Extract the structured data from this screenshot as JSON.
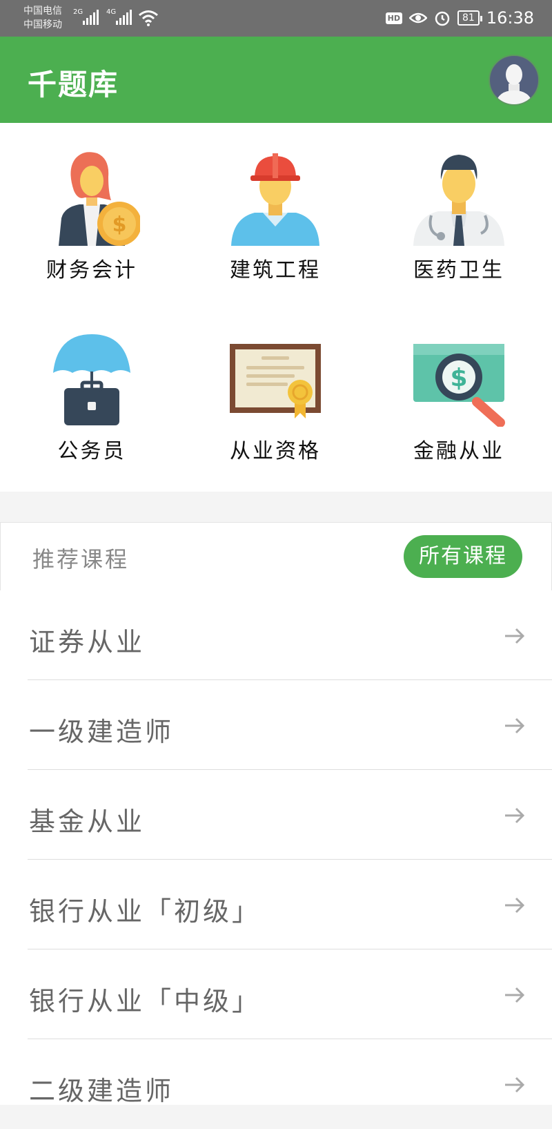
{
  "status_bar": {
    "carrier_1": "中国电信",
    "carrier_2": "中国移动",
    "net_1": "2G",
    "net_2": "4G",
    "hd": "HD",
    "battery": "81",
    "time": "16:38"
  },
  "header": {
    "title": "千题库"
  },
  "categories": [
    {
      "label": "财务会计",
      "icon": "accountant-icon"
    },
    {
      "label": "建筑工程",
      "icon": "construction-worker-icon"
    },
    {
      "label": "医药卫生",
      "icon": "doctor-icon"
    },
    {
      "label": "公务员",
      "icon": "umbrella-briefcase-icon"
    },
    {
      "label": "从业资格",
      "icon": "certificate-icon"
    },
    {
      "label": "金融从业",
      "icon": "money-magnifier-icon"
    }
  ],
  "recommend": {
    "title": "推荐课程",
    "all_button": "所有课程"
  },
  "courses": [
    {
      "label": "证券从业"
    },
    {
      "label": "一级建造师"
    },
    {
      "label": "基金从业"
    },
    {
      "label": "银行从业「初级」"
    },
    {
      "label": "银行从业「中级」"
    },
    {
      "label": "二级建造师"
    }
  ],
  "colors": {
    "brand_green": "#4caf50",
    "status_bar": "#6f6f6f"
  }
}
